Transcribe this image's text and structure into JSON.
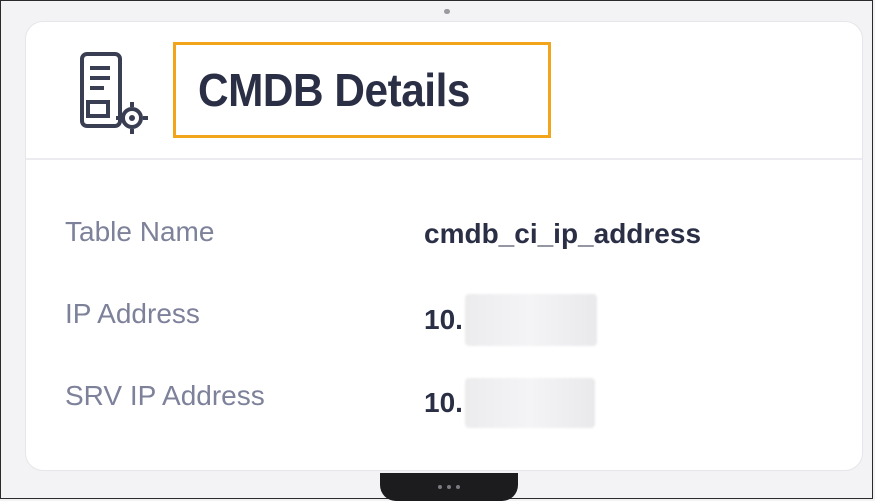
{
  "card": {
    "title": "CMDB Details",
    "icon": "server-settings-icon"
  },
  "details": [
    {
      "label": "Table Name",
      "value": "cmdb_ci_ip_address"
    },
    {
      "label": "IP Address",
      "value": "10."
    },
    {
      "label": "SRV IP Address",
      "value": "10."
    }
  ],
  "colors": {
    "highlight_border": "#f2a41b",
    "title_text": "#2a2f45",
    "label_text": "#7d819a"
  }
}
